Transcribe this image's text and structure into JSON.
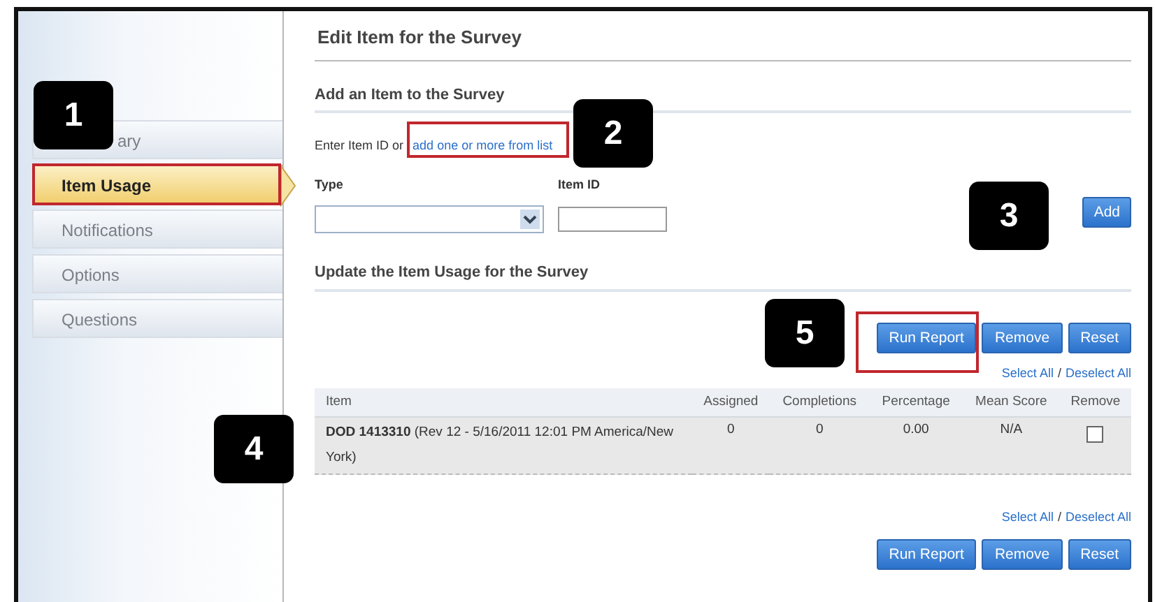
{
  "page_title": "Edit Item for the Survey",
  "sidebar": {
    "items": [
      {
        "label": "ary",
        "selected": false
      },
      {
        "label": "Item Usage",
        "selected": true
      },
      {
        "label": "Notifications",
        "selected": false
      },
      {
        "label": "Options",
        "selected": false
      },
      {
        "label": "Questions",
        "selected": false
      }
    ]
  },
  "add_section": {
    "heading": "Add an Item to the Survey",
    "prompt": "Enter Item ID or",
    "link": "add one or more from list",
    "type_label": "Type",
    "item_id_label": "Item ID",
    "add_button": "Add"
  },
  "update_section": {
    "heading": "Update the Item Usage for the Survey",
    "top_buttons": [
      "Run Report",
      "Remove",
      "Reset"
    ],
    "top_select": {
      "select_all": "Select All",
      "separator": "/",
      "deselect_all": "Deselect All"
    },
    "table": {
      "columns": [
        "Item",
        "Assigned",
        "Completions",
        "Percentage",
        "Mean Score",
        "Remove"
      ],
      "rows": [
        {
          "item": "**DOD 1413310** (Rev 12 - 5/16/2011 12:01 PM America/New York)",
          "assigned": "0",
          "completions": "0",
          "percentage": "0.00",
          "mean_score": "N/A",
          "remove_checked": false
        }
      ]
    },
    "bottom_select": {
      "select_all": "Select All",
      "separator": "/",
      "deselect_all": "Deselect All"
    },
    "bottom_buttons": [
      "Run Report",
      "Remove",
      "Reset"
    ]
  },
  "callouts": [
    {
      "label": "1"
    },
    {
      "label": "2"
    },
    {
      "label": "3"
    },
    {
      "label": "5"
    },
    {
      "label": "4"
    }
  ]
}
